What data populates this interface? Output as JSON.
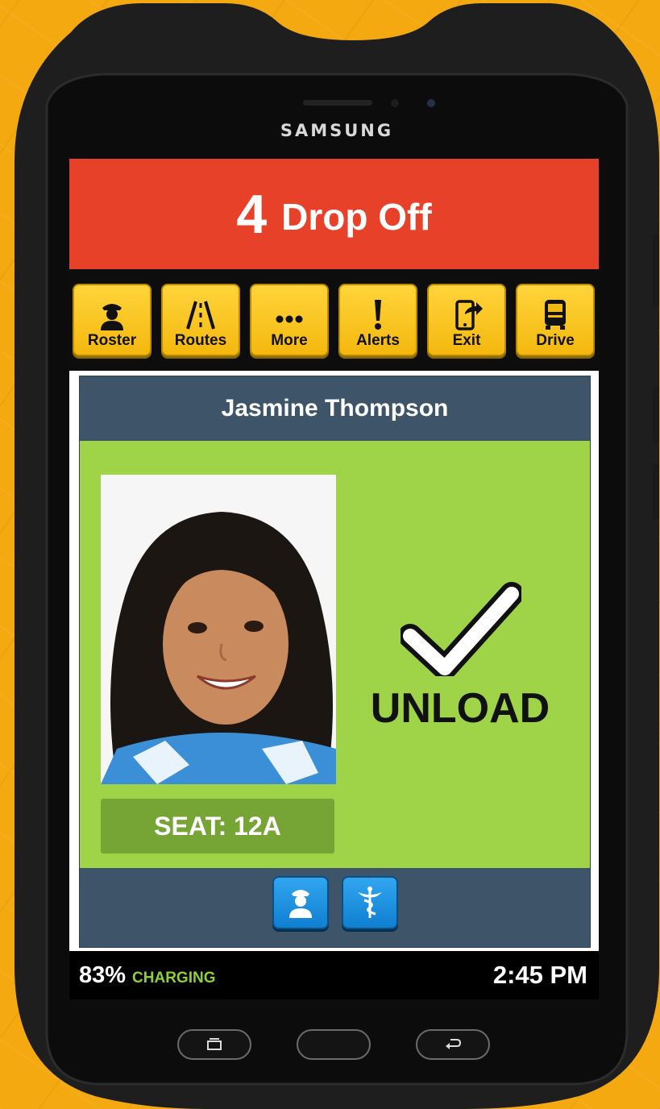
{
  "device": {
    "brand": "SAMSUNG"
  },
  "header": {
    "stop_number": "4",
    "stop_label": "Drop Off",
    "color": "#e8412a"
  },
  "toolbar": {
    "buttons": [
      {
        "label": "Roster",
        "icon": "driver-icon"
      },
      {
        "label": "Routes",
        "icon": "road-icon"
      },
      {
        "label": "More",
        "icon": "more-dots-icon"
      },
      {
        "label": "Alerts",
        "icon": "exclamation-icon"
      },
      {
        "label": "Exit",
        "icon": "phone-exit-icon"
      },
      {
        "label": "Drive",
        "icon": "bus-icon"
      }
    ]
  },
  "student": {
    "name": "Jasmine Thompson",
    "seat": "SEAT: 12A",
    "action": "UNLOAD",
    "action_icon": "checkmark-icon",
    "panel_color": "#9fd448"
  },
  "card_actions": [
    {
      "icon": "driver-profile-icon"
    },
    {
      "icon": "medical-caduceus-icon"
    }
  ],
  "status": {
    "battery": "83%",
    "charging": "CHARGING",
    "time": "2:45 PM"
  },
  "nav_keys": [
    "recent-apps-icon",
    "home-key",
    "back-arrow-icon"
  ]
}
